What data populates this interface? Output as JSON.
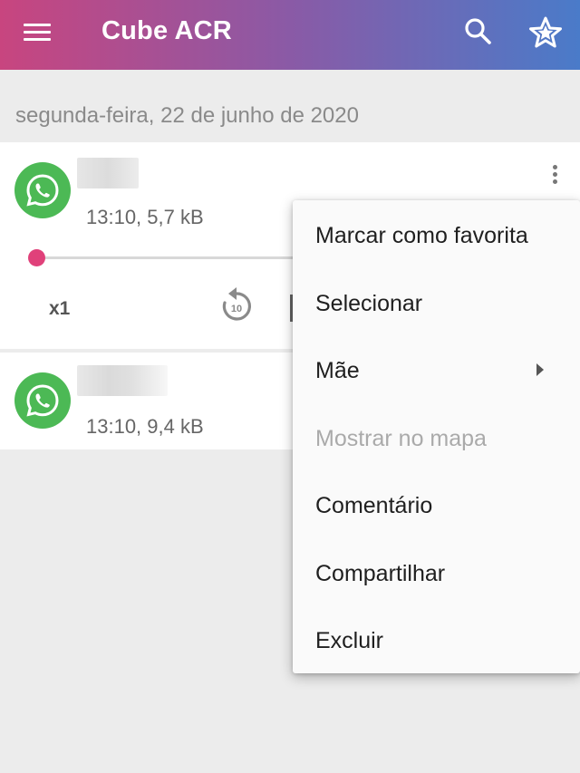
{
  "appbar": {
    "title": "Cube ACR",
    "icons": {
      "menu": "menu-icon",
      "search": "search-icon",
      "favorites": "star-icon"
    }
  },
  "date_header": "segunda-feira, 22 de junho de 2020",
  "recordings": [
    {
      "app_icon": "whatsapp-icon",
      "meta": "13:10, 5,7 kB",
      "expanded": true,
      "progress": 0.0
    },
    {
      "app_icon": "whatsapp-icon",
      "meta": "13:10, 9,4 kB",
      "expanded": false
    }
  ],
  "player": {
    "speed_label": "x1",
    "replay_label": "10",
    "accent": "#e0417a"
  },
  "popup_menu": {
    "items": [
      {
        "label": "Marcar como favorita",
        "enabled": true
      },
      {
        "label": "Selecionar",
        "enabled": true
      },
      {
        "label": "Mãe",
        "enabled": true,
        "has_submenu": true
      },
      {
        "label": "Mostrar no mapa",
        "enabled": false
      },
      {
        "label": "Comentário",
        "enabled": true
      },
      {
        "label": "Compartilhar",
        "enabled": true
      },
      {
        "label": "Excluir",
        "enabled": true
      }
    ]
  },
  "colors": {
    "gradient_start": "#c8457f",
    "gradient_end": "#4a7bc9",
    "whatsapp_green": "#4cb955"
  }
}
